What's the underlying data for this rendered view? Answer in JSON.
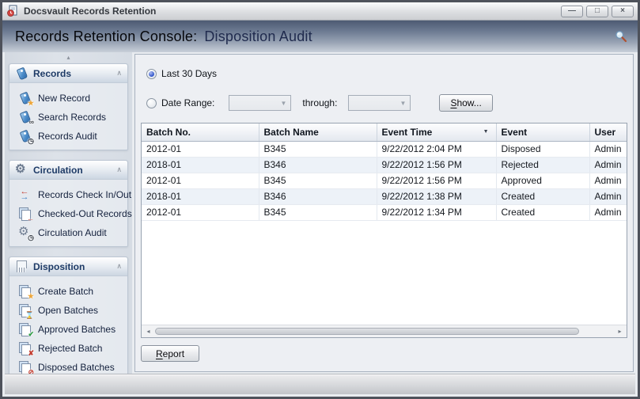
{
  "window": {
    "title": "Docsvault Records Retention",
    "controls": {
      "minimize": "—",
      "maximize": "□",
      "close": "×"
    }
  },
  "header": {
    "title_prefix": "Records Retention Console:",
    "title_current": "Disposition Audit"
  },
  "sidebar": {
    "scroll_up_icon": "▴",
    "scroll_down_icon": "▾",
    "collapse_icon": "∧",
    "groups": [
      {
        "label": "Records",
        "icon": {
          "base": "tag"
        },
        "items": [
          {
            "label": "New Record",
            "icon": {
              "base": "tag",
              "badge": "★",
              "badge_color": "#eda63a"
            }
          },
          {
            "label": "Search Records",
            "icon": {
              "base": "tag",
              "badge": "∞",
              "badge_color": "#44494f"
            }
          },
          {
            "label": "Records Audit",
            "icon": {
              "base": "tag",
              "badge": "◷",
              "badge_color": "#343b45"
            }
          }
        ]
      },
      {
        "label": "Circulation",
        "icon": {
          "base": "gear"
        },
        "items": [
          {
            "label": "Records Check In/Out",
            "icon": {
              "base": "inout"
            }
          },
          {
            "label": "Checked-Out Records",
            "icon": {
              "base": "docs",
              "badge": "←",
              "badge_color": "#c23b2e"
            }
          },
          {
            "label": "Circulation Audit",
            "icon": {
              "base": "gear",
              "badge": "◷",
              "badge_color": "#343b45"
            }
          }
        ]
      },
      {
        "label": "Disposition",
        "icon": {
          "base": "shred"
        },
        "items": [
          {
            "label": "Create Batch",
            "icon": {
              "base": "docs",
              "badge": "★",
              "badge_color": "#eda63a"
            }
          },
          {
            "label": "Open Batches",
            "icon": {
              "base": "docs",
              "badge": "⌛",
              "badge_color": "#343b45"
            }
          },
          {
            "label": "Approved Batches",
            "icon": {
              "base": "docs",
              "badge": "✔",
              "badge_color": "#2f9e44"
            }
          },
          {
            "label": "Rejected Batch",
            "icon": {
              "base": "docs",
              "badge": "✘",
              "badge_color": "#c23b2e"
            }
          },
          {
            "label": "Disposed Batches",
            "icon": {
              "base": "docs",
              "badge": "⊘",
              "badge_color": "#c23b2e"
            }
          }
        ]
      }
    ]
  },
  "filters": {
    "last_30_days": {
      "label": "Last 30 Days",
      "selected": true
    },
    "date_range": {
      "label": "Date Range:",
      "selected": false
    },
    "from_value": "",
    "through_label": "through:",
    "to_value": "",
    "show_button": {
      "label": "Show...",
      "accesskey": "S"
    }
  },
  "table": {
    "columns": [
      "Batch No.",
      "Batch Name",
      "Event Time",
      "Event",
      "User"
    ],
    "sort_column": "Event Time",
    "sort_direction": "desc",
    "sort_icon": "▼",
    "rows": [
      [
        "2012-01",
        "B345",
        "9/22/2012 2:04 PM",
        "Disposed",
        "Admin"
      ],
      [
        "2018-01",
        "B346",
        "9/22/2012 1:56 PM",
        "Rejected",
        "Admin"
      ],
      [
        "2012-01",
        "B345",
        "9/22/2012 1:56 PM",
        "Approved",
        "Admin"
      ],
      [
        "2018-01",
        "B346",
        "9/22/2012 1:38 PM",
        "Created",
        "Admin"
      ],
      [
        "2012-01",
        "B345",
        "9/22/2012 1:34 PM",
        "Created",
        "Admin"
      ]
    ],
    "scrollbar": {
      "left_icon": "◂",
      "right_icon": "▸"
    }
  },
  "footer": {
    "report_button": {
      "label": "Report",
      "accesskey": "R"
    }
  },
  "colors": {
    "header_gradient_top": "#4d5a73",
    "header_gradient_bottom": "#c9d0da",
    "row_alt": "#edf2f8",
    "radio_accent": "#2e53c9",
    "sidebar_bg": "#d8dee6"
  }
}
